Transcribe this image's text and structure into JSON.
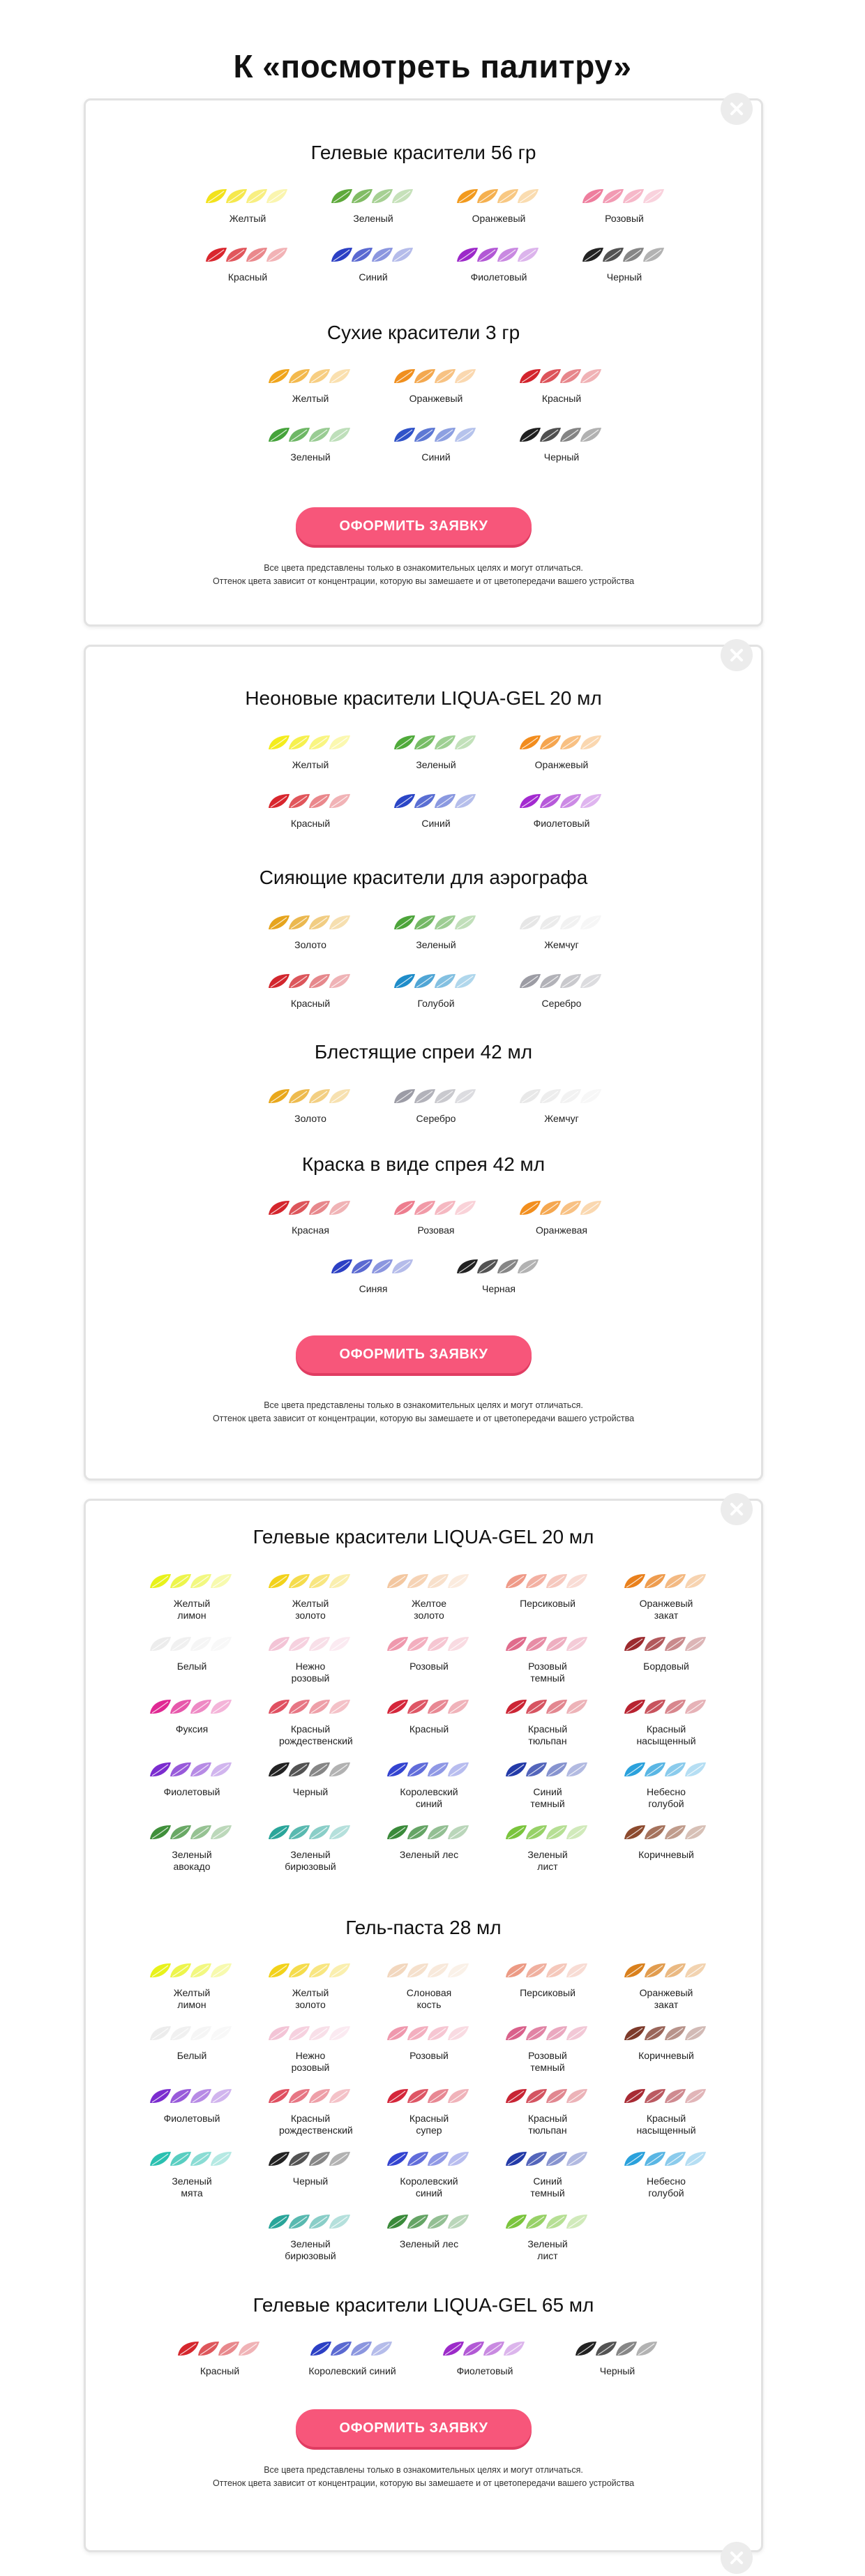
{
  "page_title": "К «посмотреть палитру»",
  "cta_label": "ОФОРМИТЬ ЗАЯВКУ",
  "note_line1": "Все цвета представлены только в ознакомительных целях и могут отличаться.",
  "note_line2": "Оттенок цвета зависит от концентрации, которую вы замешаете и от цветопередачи вашего устройства",
  "cards": [
    {
      "sections": [
        {
          "title": "Гелевые красители 56 гр",
          "items": [
            {
              "label": "Желтый",
              "color": "#f2e21a"
            },
            {
              "label": "Зеленый",
              "color": "#5da93a"
            },
            {
              "label": "Оранжевый",
              "color": "#f29a1d"
            },
            {
              "label": "Розовый",
              "color": "#ee7d9d"
            },
            {
              "label": "Красный",
              "color": "#d9262e"
            },
            {
              "label": "Синий",
              "color": "#2b3fc4"
            },
            {
              "label": "Фиолетовый",
              "color": "#9c28c9"
            },
            {
              "label": "Черный",
              "color": "#222222"
            }
          ]
        },
        {
          "title": "Сухие красители 3 гр",
          "items": [
            {
              "label": "Желтый",
              "color": "#f0a51b"
            },
            {
              "label": "Оранжевый",
              "color": "#f08f1e"
            },
            {
              "label": "Красный",
              "color": "#d3232c"
            },
            {
              "label": "Зеленый",
              "color": "#45a33a"
            },
            {
              "label": "Синий",
              "color": "#2f52c8"
            },
            {
              "label": "Черный",
              "color": "#1f1f1f"
            }
          ]
        }
      ]
    },
    {
      "sections": [
        {
          "title": "Неоновые красители LIQUA-GEL 20 мл",
          "items": [
            {
              "label": "Желтый",
              "color": "#f4ec1c"
            },
            {
              "label": "Зеленый",
              "color": "#4faa3a"
            },
            {
              "label": "Оранжевый",
              "color": "#f28c1d"
            },
            {
              "label": "Красный",
              "color": "#d8262d"
            },
            {
              "label": "Синий",
              "color": "#2a45c6"
            },
            {
              "label": "Фиолетовый",
              "color": "#a32ad0"
            }
          ]
        },
        {
          "title": "Сияющие красители для аэрографа",
          "items": [
            {
              "label": "Золото",
              "color": "#e6a41d"
            },
            {
              "label": "Зеленый",
              "color": "#4ca43a"
            },
            {
              "label": "Жемчуг",
              "color": "#e6e6e6"
            },
            {
              "label": "Красный",
              "color": "#d2262d"
            },
            {
              "label": "Голубой",
              "color": "#1e8cc9"
            },
            {
              "label": "Серебро",
              "color": "#9c9ca4"
            }
          ]
        },
        {
          "title": "Блестящие спреи 42 мл",
          "items": [
            {
              "label": "Золото",
              "color": "#e9a81c"
            },
            {
              "label": "Серебро",
              "color": "#9c9ca6"
            },
            {
              "label": "Жемчуг",
              "color": "#e8e8e8"
            }
          ]
        },
        {
          "title": "Краска в виде спрея 42 мл",
          "items": [
            {
              "label": "Красная",
              "color": "#d4252c"
            },
            {
              "label": "Розовая",
              "color": "#ed7d8e"
            },
            {
              "label": "Оранжевая",
              "color": "#f28e1d"
            },
            {
              "label": "Синяя",
              "color": "#2b3fc4"
            },
            {
              "label": "Черная",
              "color": "#222222"
            }
          ]
        }
      ]
    },
    {
      "sections": [
        {
          "title": "Гелевые красители LIQUA-GEL 20 мл",
          "items": [
            {
              "label": "Желтый лимон",
              "color": "#e8f21a"
            },
            {
              "label": "Желтый золото",
              "color": "#f2d21a"
            },
            {
              "label": "Желтое золото",
              "color": "#f3c7a0"
            },
            {
              "label": "Персиковый",
              "color": "#ef9a88"
            },
            {
              "label": "Оранжевый закат",
              "color": "#e9801c"
            },
            {
              "label": "Белый",
              "color": "#ececec"
            },
            {
              "label": "Нежно розовый",
              "color": "#f3c4d6"
            },
            {
              "label": "Розовый",
              "color": "#ef98ad"
            },
            {
              "label": "Розовый темный",
              "color": "#e06b8c"
            },
            {
              "label": "Бордовый",
              "color": "#9c2a2e"
            },
            {
              "label": "Фуксия",
              "color": "#e02893"
            },
            {
              "label": "Красный рождественский",
              "color": "#e05061"
            },
            {
              "label": "Красный",
              "color": "#d5263a"
            },
            {
              "label": "Красный тюльпан",
              "color": "#cc2434"
            },
            {
              "label": "Красный насыщенный",
              "color": "#b82230"
            },
            {
              "label": "Фиолетовый",
              "color": "#7b2ccf"
            },
            {
              "label": "Черный",
              "color": "#222222"
            },
            {
              "label": "Королевский синий",
              "color": "#3343d0"
            },
            {
              "label": "Синий темный",
              "color": "#233aa8"
            },
            {
              "label": "Небесно голубой",
              "color": "#2aa1dc"
            },
            {
              "label": "Зеленый авокадо",
              "color": "#3f8f3a"
            },
            {
              "label": "Зеленый бирюзовый",
              "color": "#2aa59a"
            },
            {
              "label": "Зеленый лес",
              "color": "#3a8a3a"
            },
            {
              "label": "Зеленый лист",
              "color": "#7ac43c"
            },
            {
              "label": "Коричневый",
              "color": "#8c4a2e"
            }
          ]
        },
        {
          "title": "Гель-паста 28 мл",
          "items": [
            {
              "label": "Желтый лимон",
              "color": "#e8f21a"
            },
            {
              "label": "Желтый золото",
              "color": "#f2d21a"
            },
            {
              "label": "Слоновая кость",
              "color": "#f2d7be"
            },
            {
              "label": "Персиковый",
              "color": "#ec9a84"
            },
            {
              "label": "Оранжевый закат",
              "color": "#d9801c"
            },
            {
              "label": "Белый",
              "color": "#ececec"
            },
            {
              "label": "Нежно розовый",
              "color": "#f3c4d6"
            },
            {
              "label": "Розовый",
              "color": "#ef98ad"
            },
            {
              "label": "Розовый темный",
              "color": "#d9608a"
            },
            {
              "label": "Коричневый",
              "color": "#7d3a2a"
            },
            {
              "label": "Фиолетовый",
              "color": "#7b2ccf"
            },
            {
              "label": "Красный рождественский",
              "color": "#e05061"
            },
            {
              "label": "Красный супер",
              "color": "#d5263a"
            },
            {
              "label": "Красный тюльпан",
              "color": "#c82434"
            },
            {
              "label": "Красный насыщенный",
              "color": "#a82a34"
            },
            {
              "label": "Зеленый мята",
              "color": "#2ac0b0"
            },
            {
              "label": "Черный",
              "color": "#222222"
            },
            {
              "label": "Королевский синий",
              "color": "#3343d0"
            },
            {
              "label": "Синий темный",
              "color": "#233aa8"
            },
            {
              "label": "Небесно голубой",
              "color": "#2aa1dc"
            },
            {
              "label": "Зеленый бирюзовый",
              "color": "#2aa59a"
            },
            {
              "label": "Зеленый лес",
              "color": "#3a8a3a"
            },
            {
              "label": "Зеленый лист",
              "color": "#7ac43c"
            }
          ]
        },
        {
          "title": "Гелевые красители LIQUA-GEL 65 мл",
          "items": [
            {
              "label": "Красный",
              "color": "#d5262d"
            },
            {
              "label": "Королевский синий",
              "color": "#2b3fc4"
            },
            {
              "label": "Фиолетовый",
              "color": "#9c2ac9"
            },
            {
              "label": "Черный",
              "color": "#222222"
            }
          ]
        }
      ]
    }
  ]
}
